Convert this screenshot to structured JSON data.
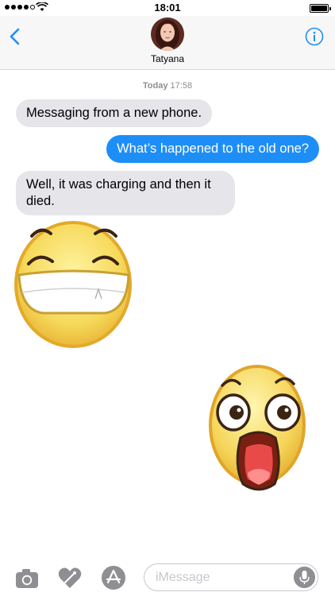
{
  "status_bar": {
    "time": "18:01",
    "signal_bars_filled": 4,
    "signal_bars_total": 5,
    "battery_level": 1.0
  },
  "header": {
    "contact_name": "Tatyana",
    "back_icon": "chevron-left-icon",
    "info_icon": "info-icon"
  },
  "conversation": {
    "timestamp_day": "Today",
    "timestamp_time": "17:58",
    "messages": [
      {
        "from": "contact",
        "text": "Messaging from a new phone."
      },
      {
        "from": "me",
        "text": "What’s happened to the old one?"
      },
      {
        "from": "contact",
        "text": "Well, it was charging and then it died."
      }
    ],
    "stickers": [
      {
        "from": "contact",
        "icon": "grinning-emoji-sticker"
      },
      {
        "from": "me",
        "icon": "shocked-emoji-sticker"
      }
    ]
  },
  "input_bar": {
    "placeholder": "iMessage",
    "value": "",
    "buttons": [
      "camera-icon",
      "digital-touch-icon",
      "app-store-icon",
      "microphone-icon"
    ]
  },
  "colors": {
    "accent": "#1e8ef7",
    "incoming_bubble": "#e5e5ea",
    "secondary_text": "#8e8e93"
  }
}
